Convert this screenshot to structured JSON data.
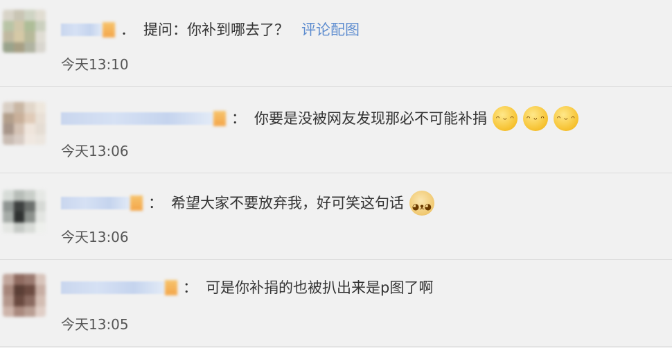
{
  "comments": [
    {
      "separator": "．",
      "text": "提问：你补到哪去了？",
      "link": "评论配图",
      "time": "今天13:10",
      "avatar_colors": [
        "#d8d4c8",
        "#c9c5b4",
        "#cfd4c4",
        "#e1ddd2",
        "#b9c4a6",
        "#d0c7a9",
        "#aebd98",
        "#cbd0bf",
        "#c0b9a0",
        "#d5c9a6",
        "#b7b99a",
        "#e0ddd4",
        "#9aa38c",
        "#a79f84",
        "#b0b3a1",
        "#d9d6cf"
      ]
    },
    {
      "separator": "：",
      "text": "你要是没被网友发现那必不可能补捐",
      "emojis": [
        "smile-emoji",
        "smile-emoji",
        "smile-emoji"
      ],
      "time": "今天13:06",
      "avatar_colors": [
        "#d9cfc5",
        "#c9b7a4",
        "#e2d7ca",
        "#eee7dd",
        "#b39f8c",
        "#c9b09a",
        "#e0cbb8",
        "#e9e0d6",
        "#a8968a",
        "#d4c2b4",
        "#efe5dc",
        "#e5ddd4",
        "#c9bcb3",
        "#d8ccc4",
        "#f0e8e1",
        "#ece6df"
      ]
    },
    {
      "separator": "：",
      "text": "希望大家不要放弃我，好可笑这句话",
      "emojis": [
        "doge-emoji"
      ],
      "time": "今天13:06",
      "avatar_colors": [
        "#d7dcd8",
        "#b7bdb8",
        "#c9cec9",
        "#e6e8e5",
        "#8f9592",
        "#3e4140",
        "#6c706d",
        "#d6d9d5",
        "#a6aca8",
        "#2f3231",
        "#8c918d",
        "#e3e5e2",
        "#e4e6e3",
        "#c6cac6",
        "#d9dcd8",
        "#eef0ed"
      ]
    },
    {
      "separator": "：",
      "text": "可是你补捐的也被扒出来是p图了啊",
      "time": "今天13:05",
      "avatar_colors": [
        "#c2a79d",
        "#8f6b60",
        "#9b7a70",
        "#d8c4bb",
        "#a6867b",
        "#5b3f36",
        "#6d4c42",
        "#c7aea4",
        "#b4978c",
        "#6a4a40",
        "#8a6a60",
        "#d3bdb3",
        "#cdb4aa",
        "#a9897e",
        "#b99e93",
        "#e0cec6"
      ]
    }
  ]
}
